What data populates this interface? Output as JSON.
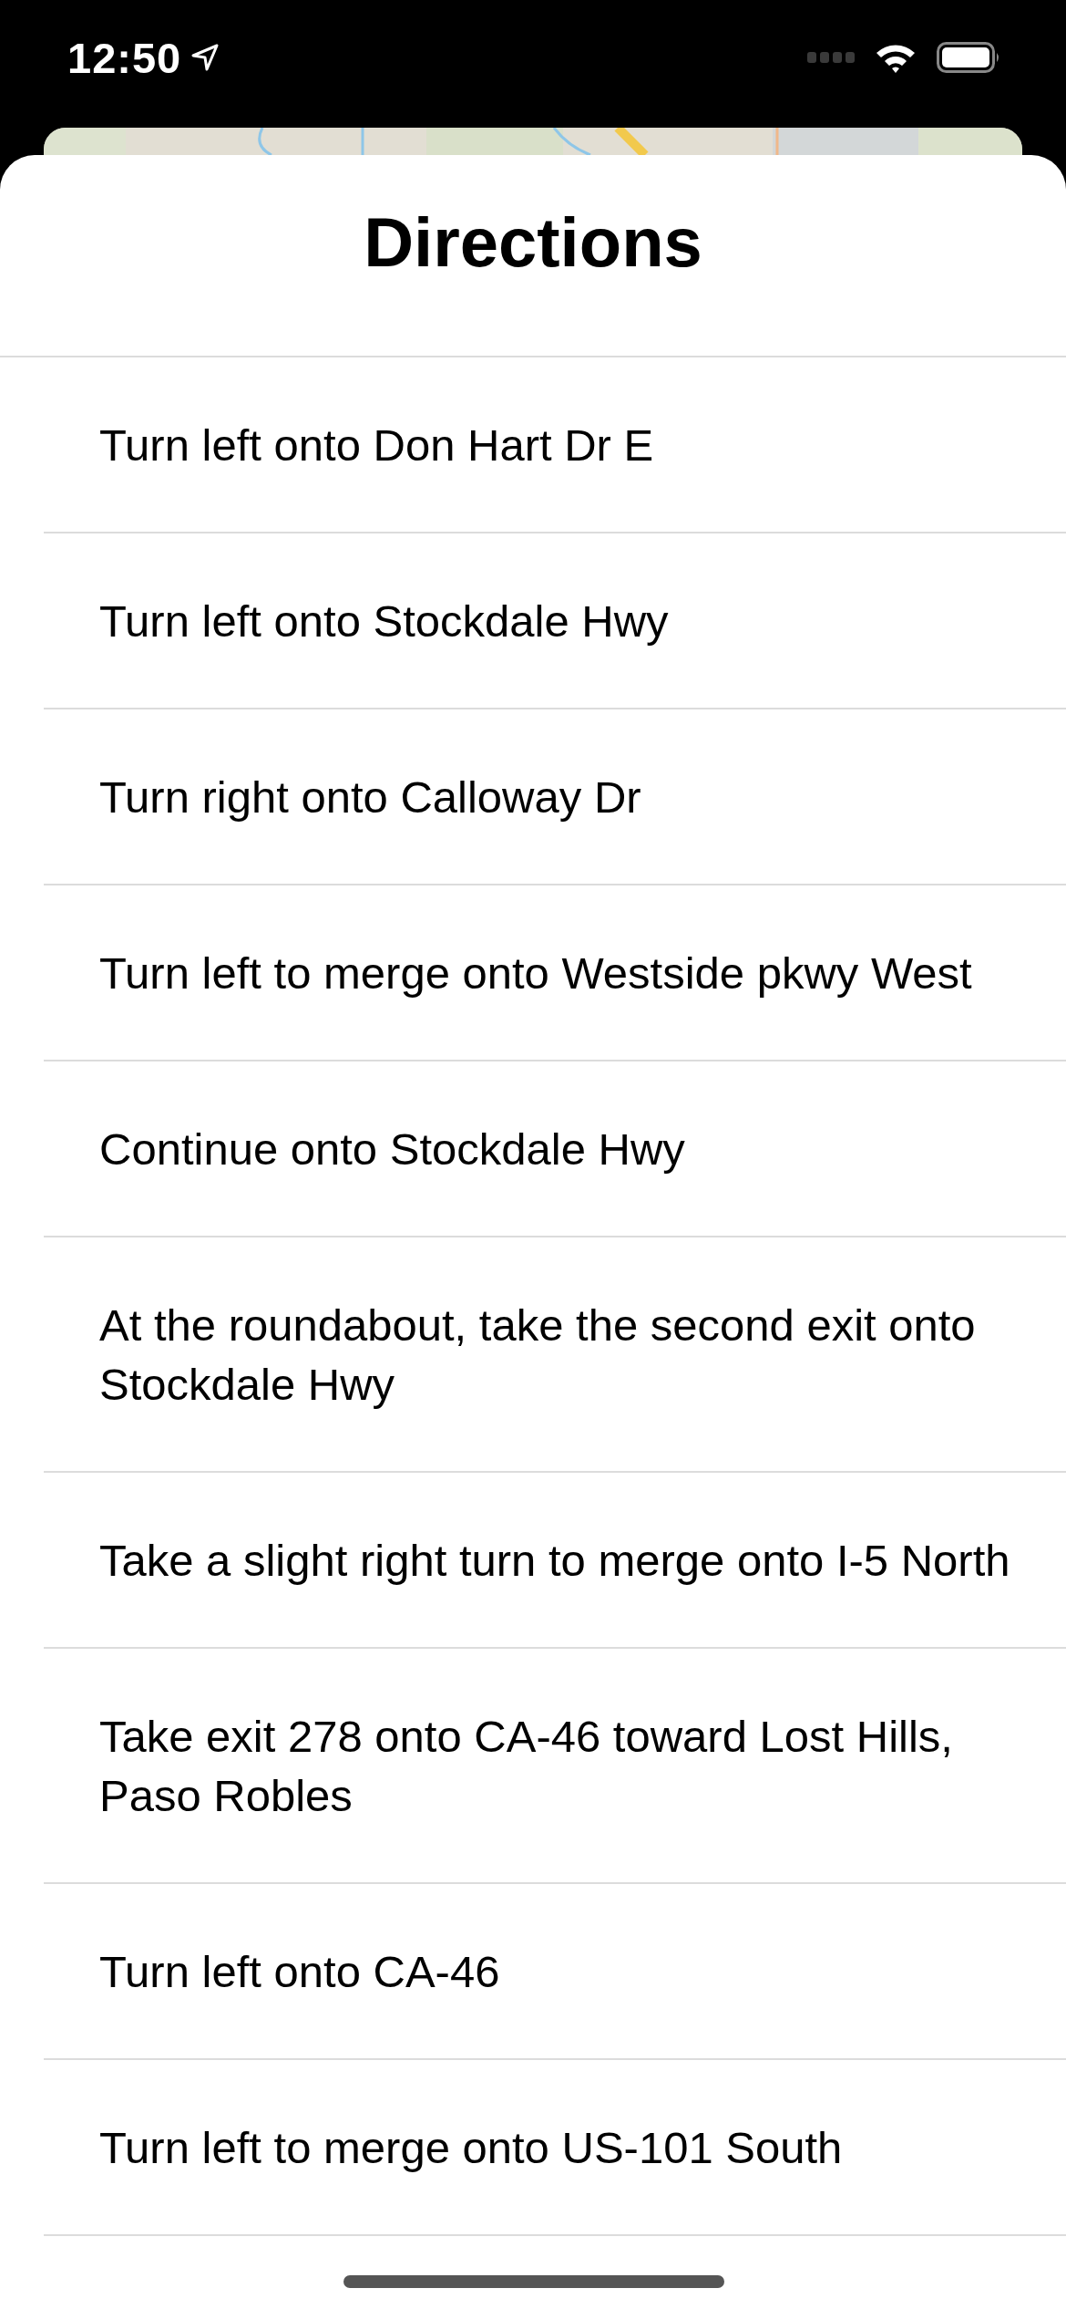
{
  "status_bar": {
    "time": "12:50"
  },
  "title": "Directions",
  "directions": [
    "Turn left onto Don Hart Dr E",
    "Turn left onto Stockdale Hwy",
    "Turn right onto Calloway Dr",
    "Turn left to merge onto Westside pkwy West",
    "Continue onto Stockdale Hwy",
    "At the roundabout, take the second exit onto Stockdale Hwy",
    "Take a slight right turn to merge onto I-5 North",
    "Take exit 278 onto CA-46 toward Lost Hills, Paso Robles",
    "Turn left onto CA-46",
    "Turn left to merge onto US-101 South"
  ]
}
